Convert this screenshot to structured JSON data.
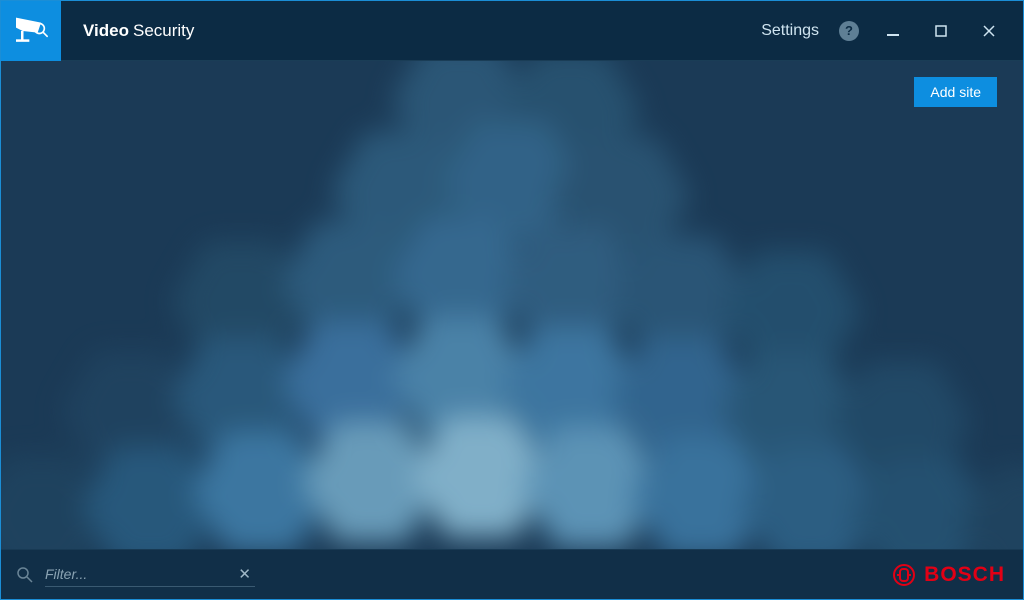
{
  "header": {
    "title_bold": "Video",
    "title_regular": "Security",
    "settings_label": "Settings",
    "help_symbol": "?"
  },
  "actions": {
    "add_site_label": "Add site"
  },
  "filter": {
    "placeholder": "Filter...",
    "clear_symbol": "✕"
  },
  "brand": {
    "name": "BOSCH"
  },
  "colors": {
    "accent": "#0d8ee0",
    "brand_red": "#e20015",
    "bg_dark": "#0c2b44"
  }
}
